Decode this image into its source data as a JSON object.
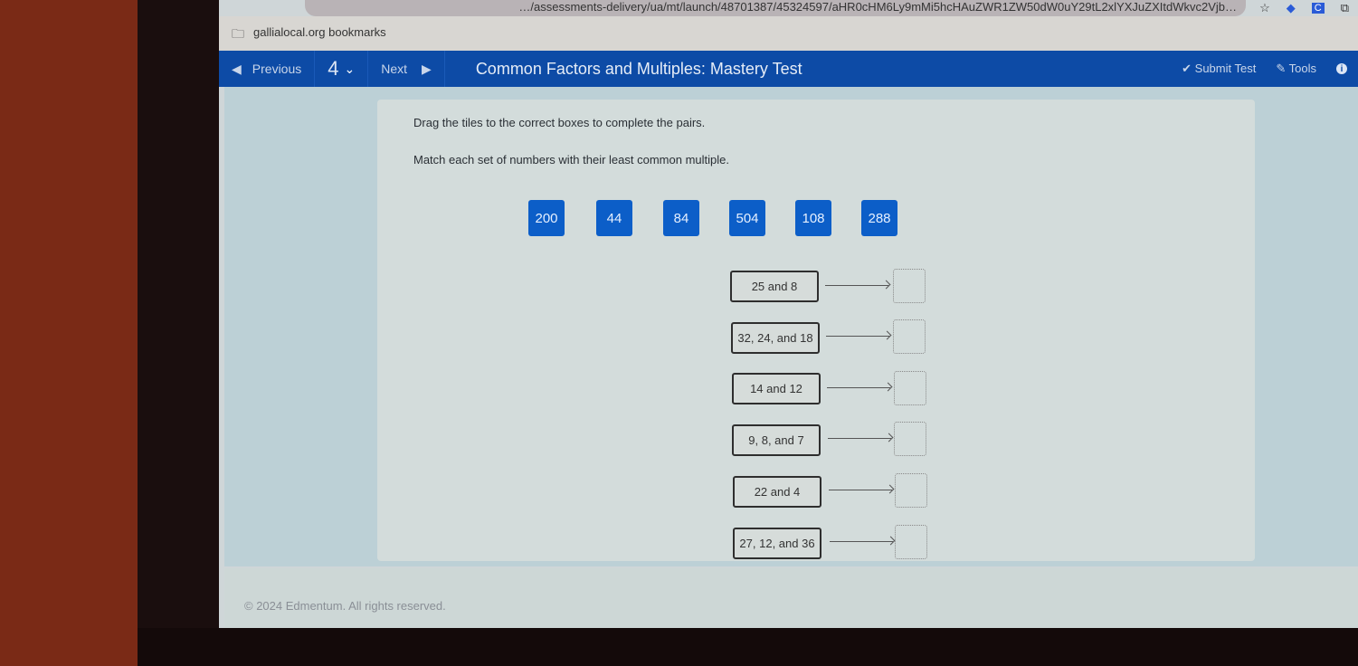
{
  "browser": {
    "url_text": "…/assessments-delivery/ua/mt/launch/48701387/45324597/aHR0cHM6Ly9mMi5hcHAuZWR1ZW50dW0uY29tL2xlYXJuZXItdWkvc2Vjb…",
    "bookmark_label": "gallialocal.org bookmarks",
    "icons": [
      "star-icon",
      "extension-icon",
      "profile-icon",
      "puzzle-icon"
    ]
  },
  "nav": {
    "previous_label": "Previous",
    "question_number": "4",
    "next_label": "Next",
    "title": "Common Factors and Multiples: Mastery Test",
    "submit_label": "Submit Test",
    "tools_label": "Tools",
    "info_badge": "i"
  },
  "question": {
    "instruction": "Drag the tiles to the correct boxes to complete the pairs.",
    "prompt": "Match each set of numbers with their least common multiple.",
    "tiles": [
      "200",
      "44",
      "84",
      "504",
      "108",
      "288"
    ],
    "pairs": [
      {
        "label": "25 and 8",
        "answer": ""
      },
      {
        "label": "32, 24, and 18",
        "answer": ""
      },
      {
        "label": "14 and 12",
        "answer": ""
      },
      {
        "label": "9, 8, and 7",
        "answer": ""
      },
      {
        "label": "22 and 4",
        "answer": ""
      },
      {
        "label": "27, 12, and 36",
        "answer": ""
      }
    ]
  },
  "footer": {
    "copyright": "© 2024 Edmentum. All rights reserved."
  },
  "colors": {
    "nav_blue": "#0d4ba6",
    "tile_blue": "#0c5ec8"
  }
}
